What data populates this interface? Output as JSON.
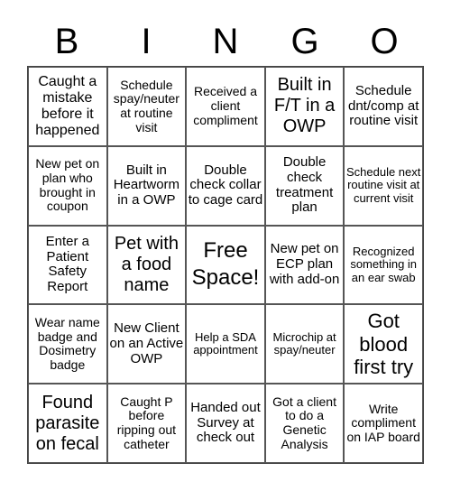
{
  "header": [
    "B",
    "I",
    "N",
    "G",
    "O"
  ],
  "cells": [
    "Caught a mistake before it happened",
    "Schedule spay/neuter at routine visit",
    "Received a client compliment",
    "Built in F/T in a OWP",
    "Schedule dnt/comp at routine visit",
    "New pet on plan who brought in coupon",
    "Built in Heartworm in a OWP",
    "Double check collar to cage card",
    "Double check treatment plan",
    "Schedule next routine visit at current visit",
    "Enter a Patient Safety Report",
    "Pet with a food name",
    "Free Space!",
    "New pet on ECP plan with add-on",
    "Recognized something in an ear swab",
    "Wear name badge and Dosimetry badge",
    "New Client on an Active OWP",
    "Help a SDA appointment",
    "Microchip at spay/neuter",
    "Got blood first try",
    "Found parasite on fecal",
    "Caught P before ripping out catheter",
    "Handed out Survey at check out",
    "Got a client to do a Genetic Analysis",
    "Write compliment on IAP board"
  ]
}
